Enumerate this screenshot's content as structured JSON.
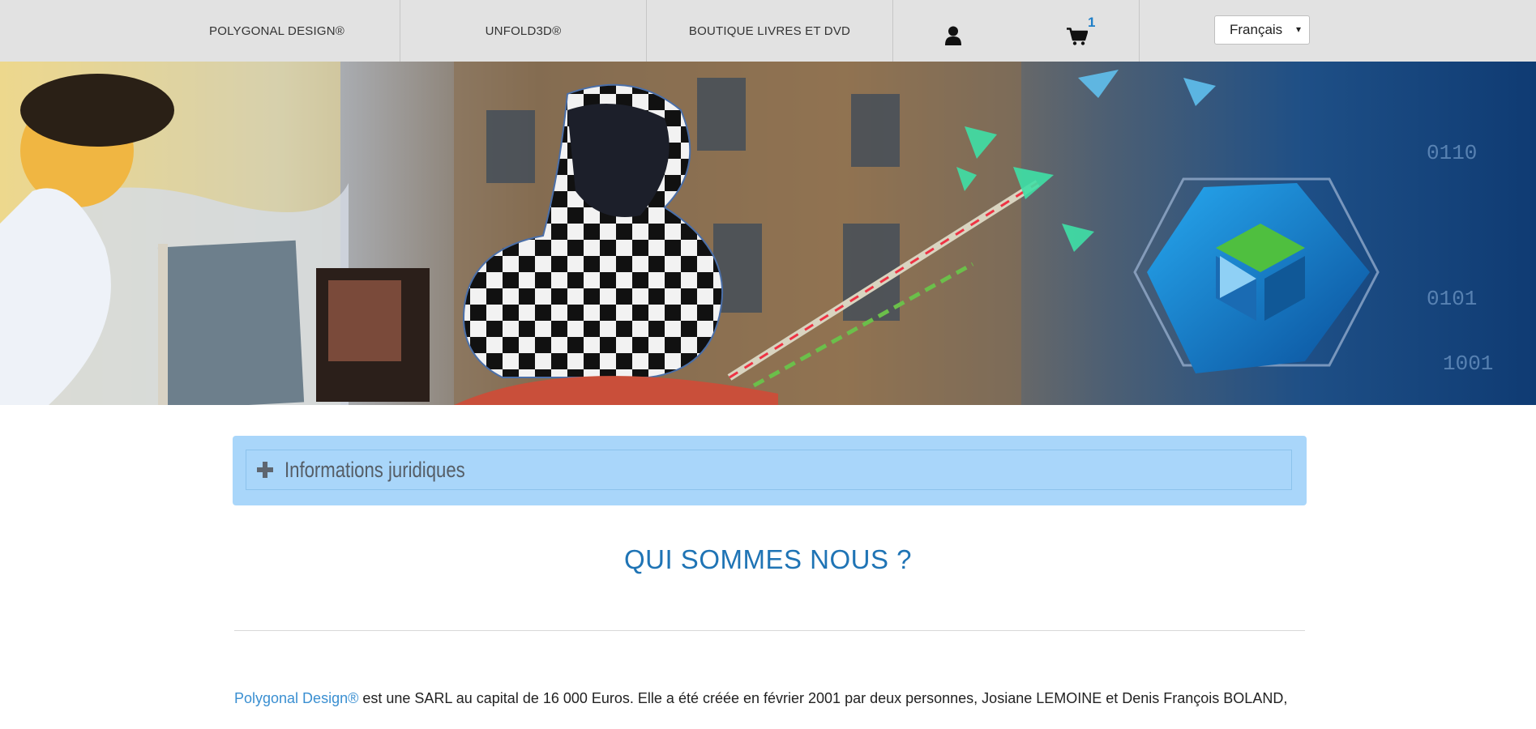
{
  "nav": {
    "items": [
      {
        "label": "POLYGONAL DESIGN®"
      },
      {
        "label": "UNFOLD3D®"
      },
      {
        "label": "BOUTIQUE LIVRES ET DVD"
      }
    ],
    "user_icon": "user-icon",
    "cart_icon": "shopping-cart-icon",
    "cart_count": "1",
    "language": {
      "selected": "Français",
      "arrow": "▾"
    }
  },
  "banner": {
    "description_icon": "hero-banner-image"
  },
  "accordion": {
    "icon": "plus-icon",
    "title": "Informations juridiques"
  },
  "about": {
    "title": "QUI SOMMES NOUS ?",
    "brand_link": "Polygonal Design®",
    "text": " est une SARL au capital de 16 000 Euros. Elle a été créée en février 2001 par deux personnes, Josiane LEMOINE et Denis François BOLAND,"
  },
  "colors": {
    "nav_background": "#e2e2e2",
    "accent_blue": "#1f74b5",
    "link_blue": "#3a8fd1",
    "accordion_background": "#a9d6fa"
  }
}
